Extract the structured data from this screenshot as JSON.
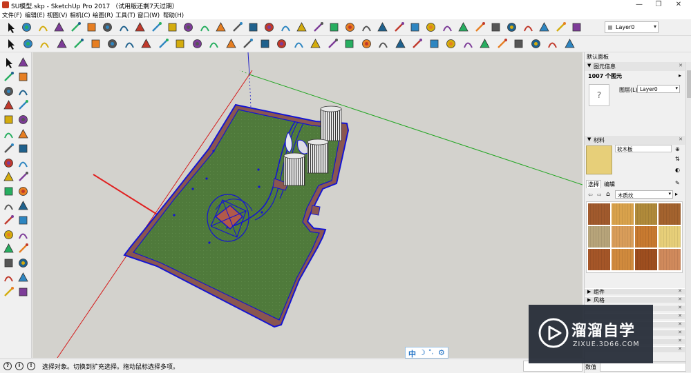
{
  "app": {
    "window_title": "SU模型.skp - SketchUp Pro 2017 （试用版还剩7天过期）",
    "window_controls": [
      "—",
      "❐",
      "✕"
    ]
  },
  "menu": {
    "items": [
      "文件(F)",
      "编辑(E)",
      "视图(V)",
      "相机(C)",
      "绘图(R)",
      "工具(T)",
      "窗口(W)",
      "帮助(H)"
    ]
  },
  "toolbar": {
    "layer_value": "Layer0",
    "row1_icons": [
      "select-arrow",
      "make-component",
      "paint-bucket",
      "eraser",
      "pencil-line",
      "freehand",
      "rectangle",
      "rotated-rectangle",
      "circle",
      "polygon",
      "arc-2pt",
      "arc-center",
      "arc-3pt",
      "pie",
      "push-pull",
      "follow-me",
      "rotate",
      "offset",
      "scale",
      "tape-measure",
      "dimension",
      "text",
      "axes",
      "protractor-3d",
      "orbit",
      "pan",
      "zoom",
      "zoom-window",
      "zoom-extents",
      "previous-view",
      "next-view",
      "walk",
      "look-around",
      "position-camera",
      "section-plane",
      "display-section"
    ],
    "row2_icons": [
      "select-arrow",
      "eraser",
      "pencil-line",
      "arc-2pt",
      "push-pull",
      "move",
      "rotate",
      "offset",
      "tape-measure",
      "text",
      "orbit",
      "pan",
      "zoom",
      "zoom-extents",
      "warehouse",
      "share-model",
      "extension-warehouse",
      "xray",
      "back-edges",
      "wireframe",
      "hidden-line",
      "shaded",
      "shaded-textures",
      "monochrome",
      "iso-view",
      "top-view",
      "front-view",
      "right-view",
      "back-view",
      "left-view",
      "house-1",
      "house-2",
      "house-3",
      "house-4"
    ]
  },
  "left_toolbar": {
    "icons": [
      "select-arrow",
      "make-component",
      "paint-bucket",
      "eraser",
      "pencil-line",
      "freehand",
      "rectangle",
      "rotated-rectangle",
      "circle",
      "polygon",
      "arc-2pt",
      "arc-3pt",
      "push-pull",
      "follow-me",
      "move",
      "rotate",
      "scale",
      "offset",
      "tape-measure",
      "dimension",
      "protractor",
      "text",
      "axes",
      "3d-text",
      "orbit",
      "pan",
      "zoom",
      "zoom-window",
      "zoom-extents",
      "previous-view",
      "position-camera",
      "look-around",
      "walk",
      "section-plane"
    ]
  },
  "view_widget": {
    "chars": [
      "中",
      "☽",
      "°,",
      "⚙"
    ]
  },
  "tray": {
    "title": "默认面板",
    "entity_info": {
      "header": "图元信息",
      "count": "1007 个图元",
      "layer_label": "图层(L):",
      "layer_value": "Layer0",
      "preview_glyph": "?"
    },
    "materials": {
      "header": "材料",
      "name": "软木板",
      "tab_select": "选择",
      "tab_edit": "编辑",
      "library": "木质纹",
      "swatch_colors": [
        "#a15a2d",
        "#d9a24c",
        "#b08a3a",
        "#a4632e",
        "#b7a47a",
        "#d99d5a",
        "#c87a30",
        "#e7cf79",
        "#a55628",
        "#d08a3d",
        "#9e4e1f",
        "#d08a5c"
      ]
    },
    "collapsed_panels": [
      "组件",
      "风格"
    ],
    "bottom_label": "数值"
  },
  "status": {
    "text": "选择对象。切换到扩充选择。拖动鼠标选择多项。",
    "icons": [
      "?",
      "i",
      "!"
    ]
  },
  "watermark": {
    "text_cn": "溜溜自学",
    "url": "ZIXUE.3D66.COM"
  },
  "colors": {
    "viewport_bg": "#d3d2cd",
    "ground_green": "#4f7a3b",
    "selection_blue": "#1414d2",
    "axis_red": "#d41c1c",
    "axis_green": "#23a623",
    "axis_blue": "#2020c8",
    "pavement_brown": "#8a5650"
  }
}
